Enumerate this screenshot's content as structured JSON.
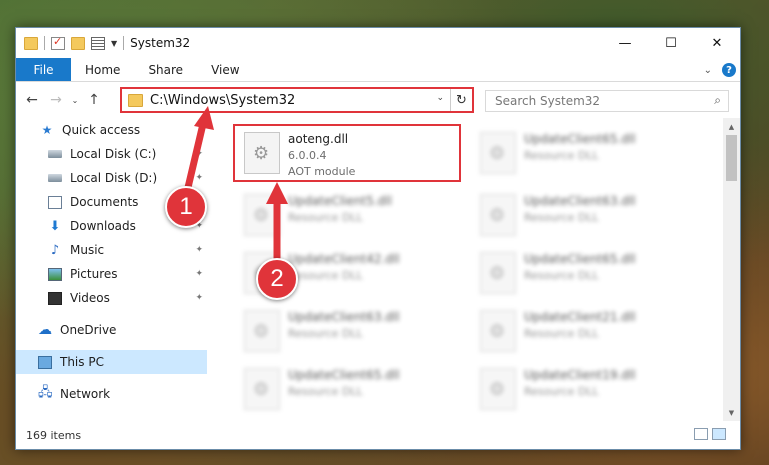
{
  "window": {
    "title": "System32"
  },
  "caption": {
    "minimize": "—",
    "maximize": "☐",
    "close": "✕"
  },
  "ribbon": {
    "file": "File",
    "tabs": [
      "Home",
      "Share",
      "View"
    ],
    "collapse": "⌄",
    "help": "?"
  },
  "nav": {
    "back": "←",
    "forward": "→",
    "recent": "⌄",
    "up": "↑"
  },
  "address": {
    "path": "C:\\Windows\\System32",
    "dropdown": "⌄",
    "refresh": "↻"
  },
  "search": {
    "placeholder": "Search System32",
    "icon": "⌕"
  },
  "sidebar": {
    "items": [
      {
        "label": "Quick access",
        "icon": "star-icon",
        "pinned": false
      },
      {
        "label": "Local Disk (C:)",
        "icon": "drive-icon",
        "pinned": true
      },
      {
        "label": "Local Disk (D:)",
        "icon": "drive-icon",
        "pinned": true
      },
      {
        "label": "Documents",
        "icon": "documents-icon",
        "pinned": true
      },
      {
        "label": "Downloads",
        "icon": "download-icon",
        "pinned": true
      },
      {
        "label": "Music",
        "icon": "music-icon",
        "pinned": true
      },
      {
        "label": "Pictures",
        "icon": "pictures-icon",
        "pinned": true
      },
      {
        "label": "Videos",
        "icon": "videos-icon",
        "pinned": true
      },
      {
        "label": "OneDrive",
        "icon": "cloud-icon",
        "pinned": false
      },
      {
        "label": "This PC",
        "icon": "pc-icon",
        "pinned": false,
        "selected": true
      },
      {
        "label": "Network",
        "icon": "network-icon",
        "pinned": false
      }
    ],
    "pin_glyph": "📌"
  },
  "files": {
    "highlighted": {
      "name": "aoteng.dll",
      "version": "6.0.0.4",
      "type": "AOT module"
    },
    "col1": [
      {
        "name": "UpdateClient5.dll",
        "type": "Resource DLL"
      },
      {
        "name": "UpdateClient42.dll",
        "type": "Resource DLL"
      },
      {
        "name": "UpdateClient63.dll",
        "type": "Resource DLL"
      },
      {
        "name": "UpdateClient65.dll",
        "type": "Resource DLL"
      }
    ],
    "col2": [
      {
        "name": "UpdateClient65.dll",
        "type": "Resource DLL"
      },
      {
        "name": "UpdateClient63.dll",
        "type": "Resource DLL"
      },
      {
        "name": "UpdateClient65.dll",
        "type": "Resource DLL"
      },
      {
        "name": "UpdateClient21.dll",
        "type": "Resource DLL"
      },
      {
        "name": "UpdateClient19.dll",
        "type": "Resource DLL"
      }
    ]
  },
  "status": {
    "count": "169 items"
  },
  "callouts": {
    "one": "1",
    "two": "2"
  },
  "colors": {
    "accent": "#1979ca",
    "highlight": "#e0343a",
    "selected": "#cce8ff"
  }
}
